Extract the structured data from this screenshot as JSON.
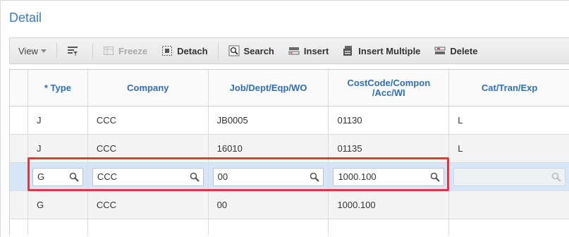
{
  "panel": {
    "title": "Detail"
  },
  "toolbar": {
    "view_label": "View",
    "freeze_label": "Freeze",
    "detach_label": "Detach",
    "search_label": "Search",
    "insert_label": "Insert",
    "insert_multiple_label": "Insert Multiple",
    "delete_label": "Delete"
  },
  "grid": {
    "columns": [
      "* Type",
      "Company",
      "Job/Dept/Eqp/WO",
      "CostCode/Compon\n/Acc/WI",
      "Cat/Tran/Exp"
    ],
    "rows": [
      {
        "type": "J",
        "company": "CCC",
        "job": "JB0005",
        "costcode": "01130",
        "cat": "L"
      },
      {
        "type": "J",
        "company": "CCC",
        "job": "16010",
        "costcode": "01135",
        "cat": "L"
      }
    ],
    "edit_row": {
      "type": "G",
      "company": "CCC",
      "job": "00",
      "costcode": "1000.100",
      "cat": ""
    },
    "last_row": {
      "type": "G",
      "company": "CCC",
      "job": "00",
      "costcode": "1000.100",
      "cat": ""
    }
  },
  "colors": {
    "accent": "#3a7bc8",
    "highlight": "#e2383b",
    "edit_row_bg": "#d6e5f7"
  }
}
